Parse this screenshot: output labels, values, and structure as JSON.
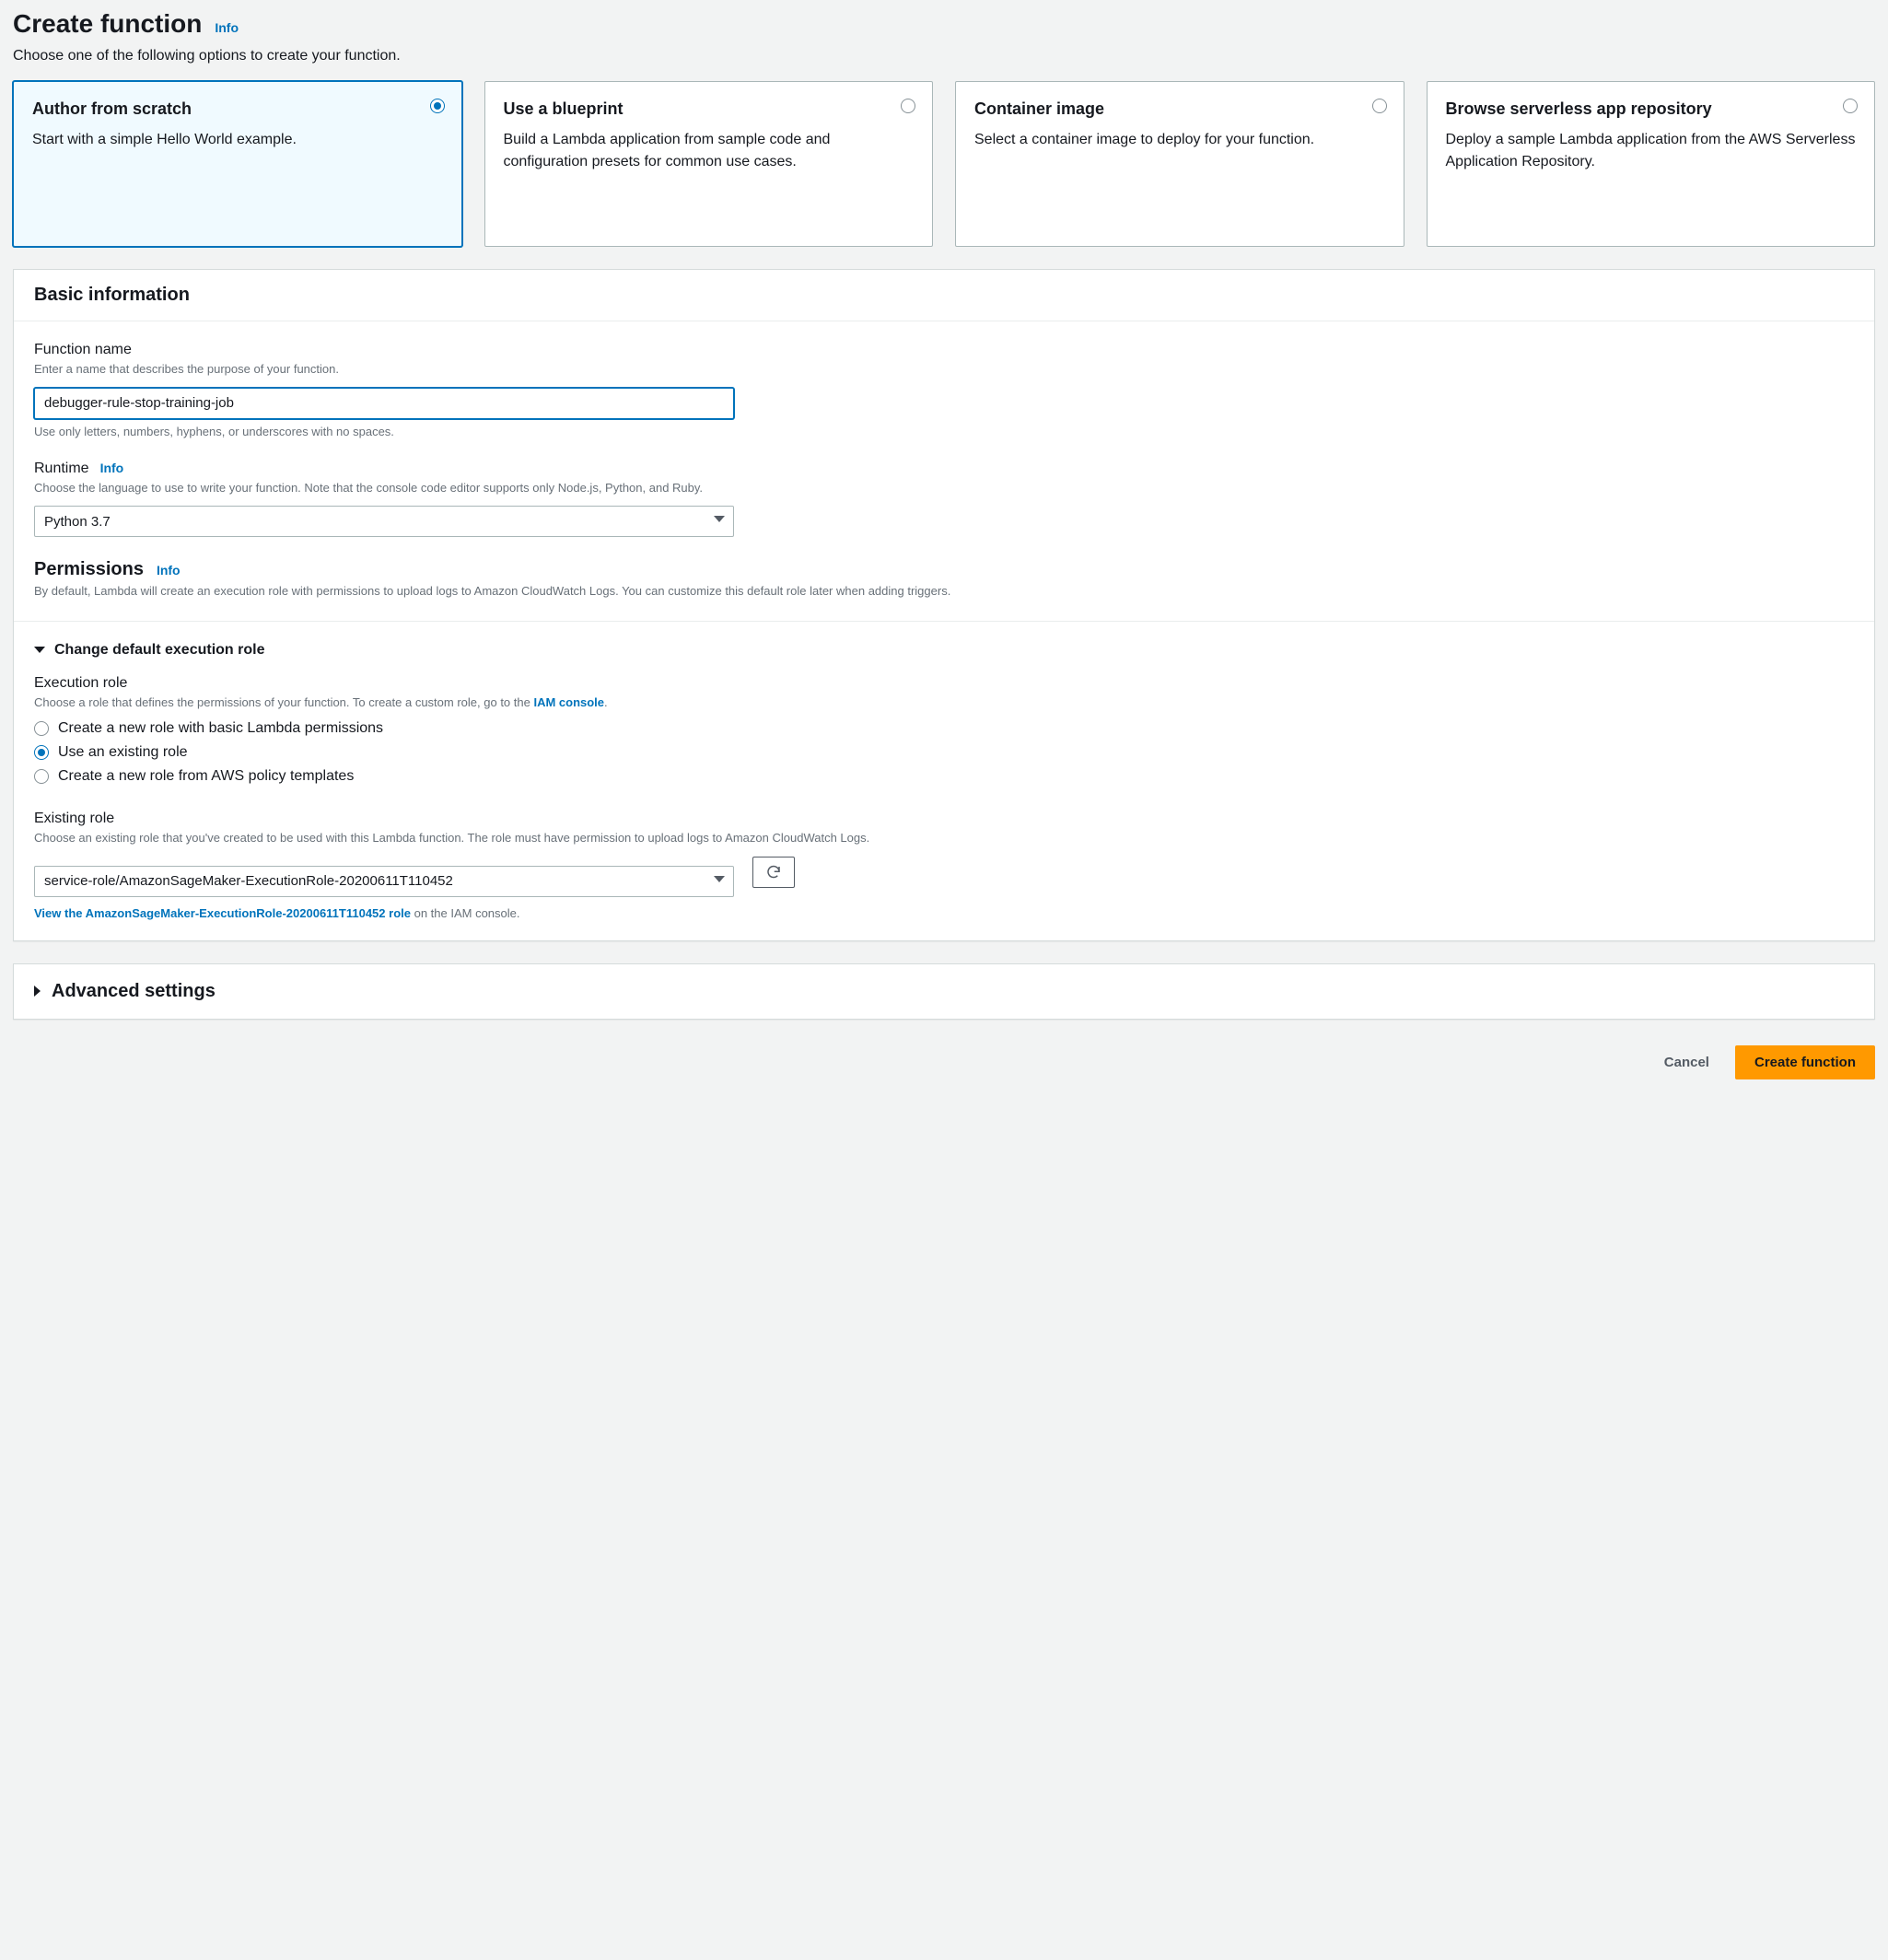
{
  "pageTitle": "Create function",
  "infoLabel": "Info",
  "pageSubtext": "Choose one of the following options to create your function.",
  "options": [
    {
      "title": "Author from scratch",
      "desc": "Start with a simple Hello World example.",
      "selected": true
    },
    {
      "title": "Use a blueprint",
      "desc": "Build a Lambda application from sample code and configuration presets for common use cases.",
      "selected": false
    },
    {
      "title": "Container image",
      "desc": "Select a container image to deploy for your function.",
      "selected": false
    },
    {
      "title": "Browse serverless app repository",
      "desc": "Deploy a sample Lambda application from the AWS Serverless Application Repository.",
      "selected": false
    }
  ],
  "basic": {
    "panelTitle": "Basic information",
    "functionName": {
      "label": "Function name",
      "hint": "Enter a name that describes the purpose of your function.",
      "value": "debugger-rule-stop-training-job",
      "note": "Use only letters, numbers, hyphens, or underscores with no spaces."
    },
    "runtime": {
      "label": "Runtime",
      "infoLabel": "Info",
      "hint": "Choose the language to use to write your function. Note that the console code editor supports only Node.js, Python, and Ruby.",
      "value": "Python 3.7"
    },
    "permissions": {
      "heading": "Permissions",
      "infoLabel": "Info",
      "hint": "By default, Lambda will create an execution role with permissions to upload logs to Amazon CloudWatch Logs. You can customize this default role later when adding triggers."
    }
  },
  "executionRole": {
    "expanderLabel": "Change default execution role",
    "label": "Execution role",
    "hintPrefix": "Choose a role that defines the permissions of your function. To create a custom role, go to the ",
    "iamLinkText": "IAM console",
    "hintSuffix": ".",
    "radios": [
      {
        "label": "Create a new role with basic Lambda permissions",
        "checked": false
      },
      {
        "label": "Use an existing role",
        "checked": true
      },
      {
        "label": "Create a new role from AWS policy templates",
        "checked": false
      }
    ],
    "existingRole": {
      "label": "Existing role",
      "hint": "Choose an existing role that you've created to be used with this Lambda function. The role must have permission to upload logs to Amazon CloudWatch Logs.",
      "value": "service-role/AmazonSageMaker-ExecutionRole-20200611T110452",
      "viewLinkText": "View the AmazonSageMaker-ExecutionRole-20200611T110452 role",
      "viewTrailText": " on the IAM console."
    }
  },
  "advanced": {
    "heading": "Advanced settings"
  },
  "footer": {
    "cancel": "Cancel",
    "submit": "Create function"
  }
}
